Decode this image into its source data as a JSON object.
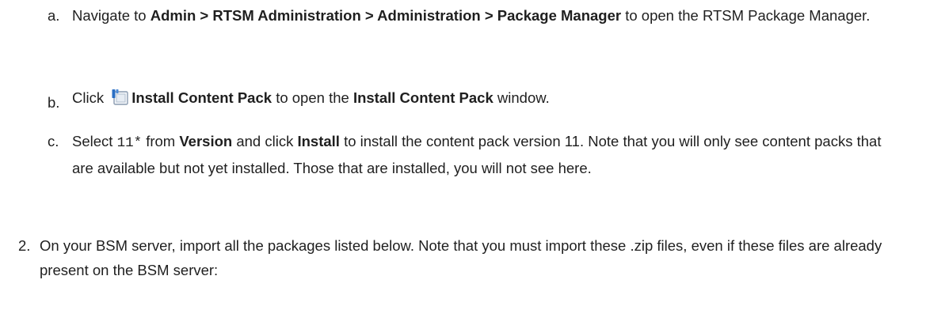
{
  "steps": {
    "a": {
      "marker": "a.",
      "t1": "Navigate to ",
      "b1": "Admin > RTSM Administration > Administration > Package Manager",
      "t2": " to open the RTSM Package Manager."
    },
    "b": {
      "marker": "b.",
      "t1": "Click ",
      "icon": "install-content-pack-icon",
      "b1": "Install Content Pack",
      "t2": " to open the ",
      "b2": "Install Content Pack",
      "t3": " window."
    },
    "c": {
      "marker": "c.",
      "t1": "Select ",
      "code1": "11*",
      "t2": " from ",
      "b1": "Version",
      "t3": " and click ",
      "b2": "Install",
      "t4": " to install the content pack version 11. Note that you will only see content packs that are available but not yet installed. Those that are installed, you will not see here."
    },
    "two": {
      "marker": "2.",
      "t1": "On your BSM server, import all the packages listed below. Note that you must import these .zip files, even if these files are already present on the BSM server:"
    }
  },
  "colors": {
    "text": "#1f1f1f",
    "icon_blue": "#2b6fc4",
    "icon_light": "#cfd8e4"
  }
}
